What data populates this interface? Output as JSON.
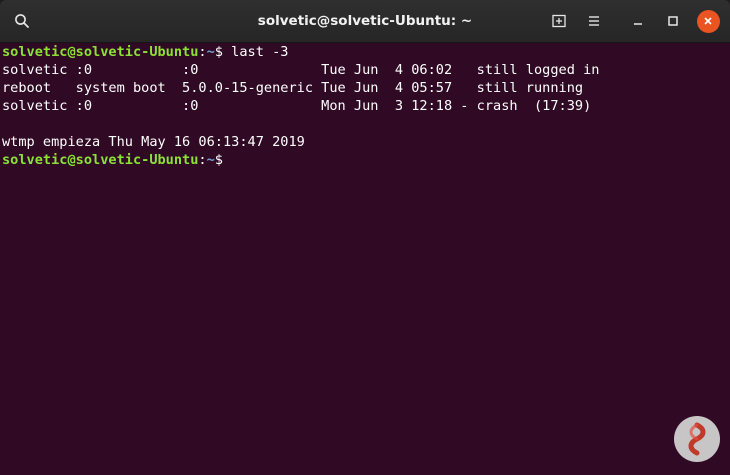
{
  "window": {
    "title": "solvetic@solvetic-Ubuntu: ~"
  },
  "toolbar": {
    "search_icon": "search-icon",
    "new_tab_icon": "new-tab-icon",
    "menu_icon": "hamburger-menu-icon",
    "minimize_icon": "minimize-icon",
    "maximize_icon": "maximize-icon",
    "close_icon": "close-icon"
  },
  "terminal": {
    "prompt_user": "solvetic@solvetic-Ubuntu",
    "prompt_colon": ":",
    "prompt_path": "~",
    "prompt_dollar": "$ ",
    "command": "last -3",
    "output": [
      "solvetic :0           :0               Tue Jun  4 06:02   still logged in",
      "reboot   system boot  5.0.0-15-generic Tue Jun  4 05:57   still running",
      "solvetic :0           :0               Mon Jun  3 12:18 - crash  (17:39)",
      "",
      "wtmp empieza Thu May 16 06:13:47 2019"
    ]
  },
  "colors": {
    "terminal_bg": "#300a24",
    "prompt_user": "#8ae234",
    "prompt_path": "#729fcf",
    "close_button": "#e95420"
  }
}
